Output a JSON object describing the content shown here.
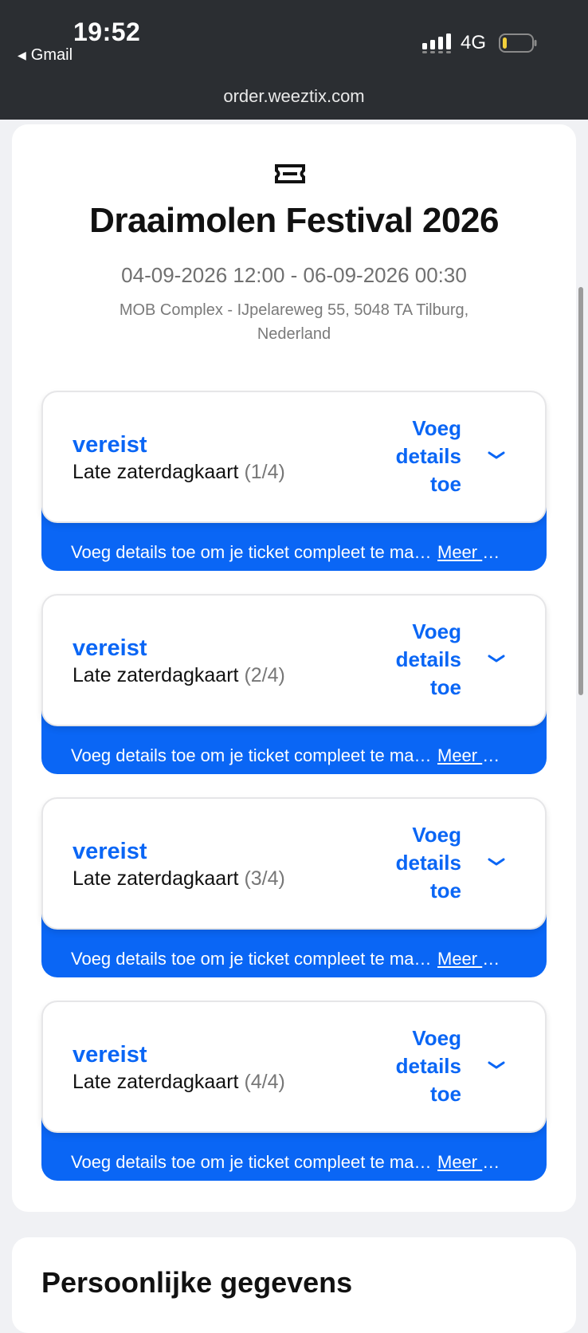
{
  "status_bar": {
    "time": "19:52",
    "back_app": "Gmail",
    "network": "4G",
    "url": "order.weeztix.com"
  },
  "event": {
    "title": "Draaimolen Festival 2026",
    "dates": "04-09-2026 12:00 - 06-09-2026 00:30",
    "location": "MOB Complex - IJpelareweg 55, 5048 TA Tilburg, Nederland"
  },
  "tickets": [
    {
      "required_label": "vereist",
      "name": "Late zaterdagkaart",
      "count": "(1/4)",
      "add_details": "Voeg details toe",
      "footer_text": "Voeg details toe om je ticket compleet te maken.",
      "footer_link": "Meer informatie"
    },
    {
      "required_label": "vereist",
      "name": "Late zaterdagkaart",
      "count": "(2/4)",
      "add_details": "Voeg details toe",
      "footer_text": "Voeg details toe om je ticket compleet te maken.",
      "footer_link": "Meer informatie"
    },
    {
      "required_label": "vereist",
      "name": "Late zaterdagkaart",
      "count": "(3/4)",
      "add_details": "Voeg details toe",
      "footer_text": "Voeg details toe om je ticket compleet te maken.",
      "footer_link": "Meer informatie"
    },
    {
      "required_label": "vereist",
      "name": "Late zaterdagkaart",
      "count": "(4/4)",
      "add_details": "Voeg details toe",
      "footer_text": "Voeg details toe om je ticket compleet te maken.",
      "footer_link": "Meer informatie"
    }
  ],
  "next_section": {
    "title": "Persoonlijke gegevens"
  },
  "icons": {
    "ticket": "ticket-icon",
    "chevron": "chevron-down-icon",
    "signal": "signal-icon",
    "battery": "battery-icon",
    "back": "back-arrow-icon"
  },
  "colors": {
    "accent": "#0a66f5",
    "status_bar": "#2b2e32",
    "battery_low": "#f2d03b"
  }
}
